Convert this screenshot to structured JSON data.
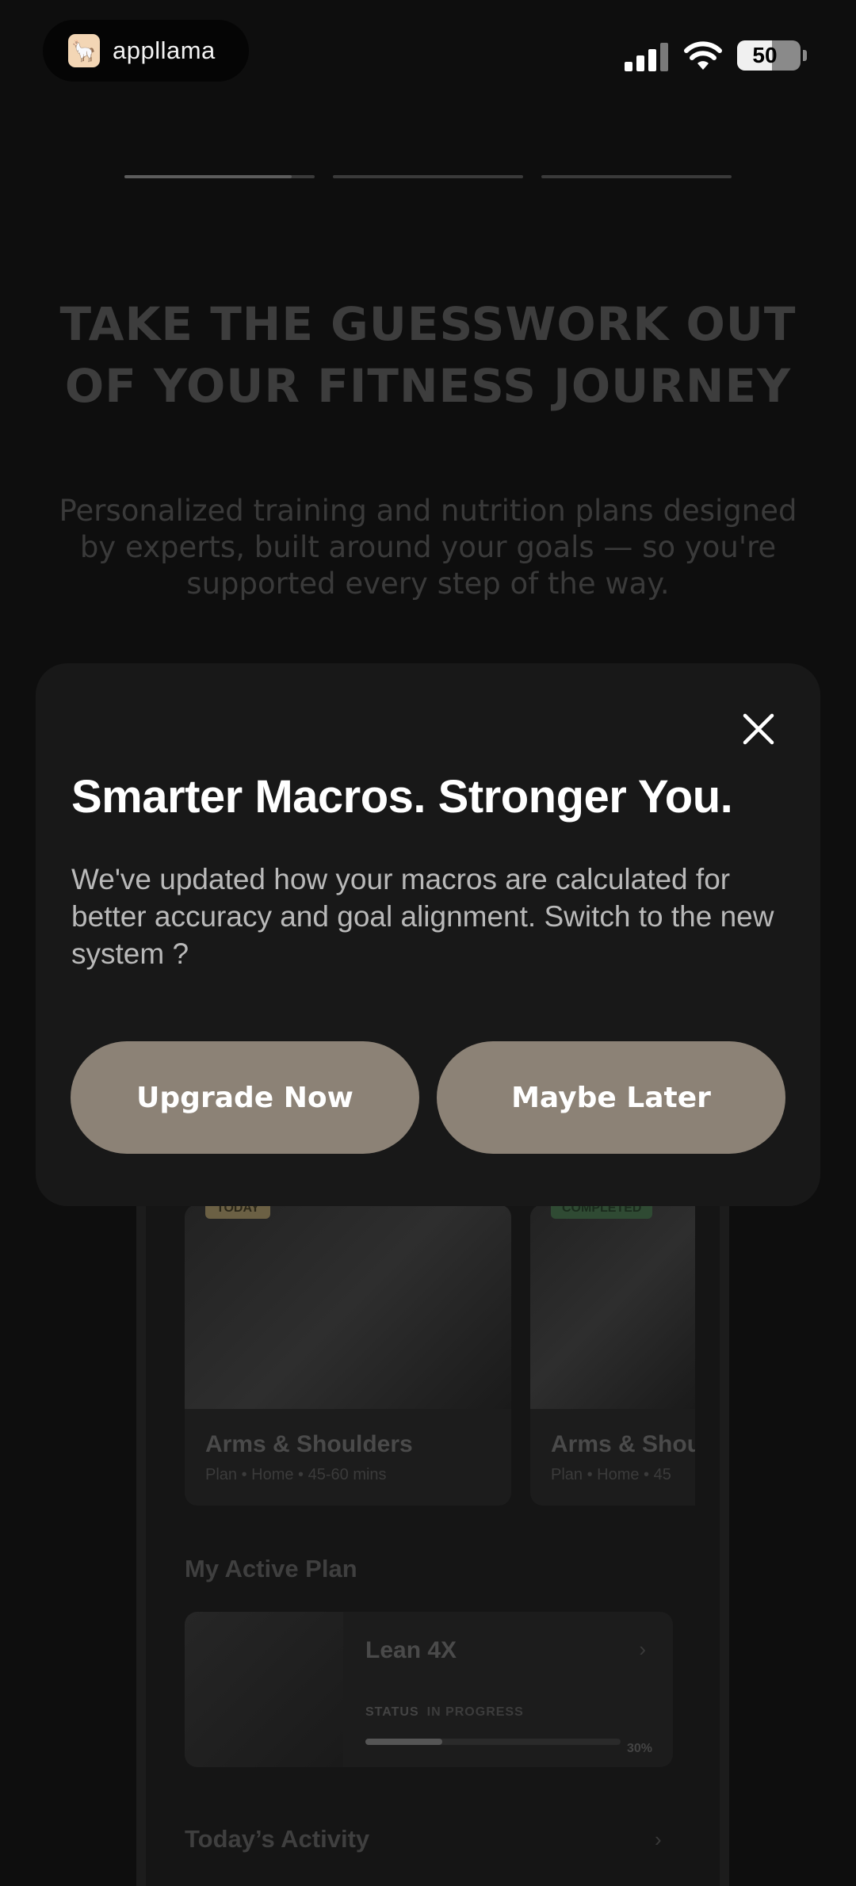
{
  "status_bar": {
    "brand_name": "appllama",
    "battery": "50"
  },
  "onboarding": {
    "step_count": 3,
    "current_step_progress": 0.88,
    "title": "TAKE THE GUESSWORK OUT OF YOUR FITNESS JOURNEY",
    "subtitle": "Personalized training and nutrition plans designed by experts, built around your goals — so you're supported every step of the way."
  },
  "preview": {
    "cards": [
      {
        "badge": "TODAY",
        "badge_color": "#8a7a52",
        "title": "Arms & Shoulders",
        "meta": "Plan • Home • 45-60 mins"
      },
      {
        "badge": "COMPLETED",
        "badge_color": "#3f6a46",
        "title": "Arms & Shou",
        "meta": "Plan • Home • 45"
      }
    ],
    "active_plan_heading": "My Active Plan",
    "plan": {
      "name": "Lean 4X",
      "status_label": "STATUS",
      "status_value": "IN PROGRESS",
      "progress": 0.3,
      "progress_text": "30%"
    },
    "activity_heading": "Today’s Activity"
  },
  "modal": {
    "title": "Smarter Macros. Stronger You.",
    "body": "We've updated how your macros are calculated for better accuracy and goal alignment. Switch to the new system ?",
    "primary_button": "Upgrade Now",
    "secondary_button": "Maybe Later",
    "close_icon": "close-icon",
    "button_color": "#8c8276"
  }
}
